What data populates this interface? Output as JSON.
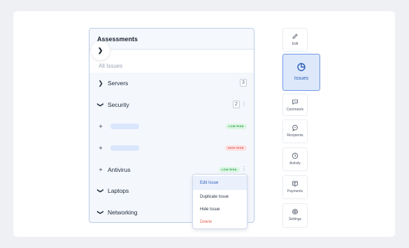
{
  "panel": {
    "title": "Assessments",
    "subheading": "All Issues",
    "rows": [
      {
        "label": "Servers",
        "count": "3"
      },
      {
        "label": "Security",
        "count": "2"
      },
      {
        "badge": "LOW RISK"
      },
      {
        "badge": "HIGH RISK"
      },
      {
        "label": "Antivirus",
        "badge": "LOW RISK"
      },
      {
        "label": "Laptops"
      },
      {
        "label": "Networking"
      }
    ]
  },
  "context_menu": {
    "items": [
      "Edit Issue",
      "Duplicate Issue",
      "Hide Issue",
      "Delete"
    ]
  },
  "side_toolbar": {
    "items": [
      {
        "label": "Edit",
        "icon": "pencil-icon"
      },
      {
        "label": "Issues",
        "icon": "pie-chart-icon"
      },
      {
        "label": "Comments",
        "icon": "chat-icon"
      },
      {
        "label": "Recipients",
        "icon": "chat-dots-icon"
      },
      {
        "label": "Activity",
        "icon": "clock-icon"
      },
      {
        "label": "Payments",
        "icon": "receipt-icon"
      },
      {
        "label": "Settings",
        "icon": "gear-icon"
      }
    ]
  },
  "colors": {
    "accent": "#2c5fb6",
    "low_risk": "#27a047",
    "high_risk": "#e24c4c"
  }
}
